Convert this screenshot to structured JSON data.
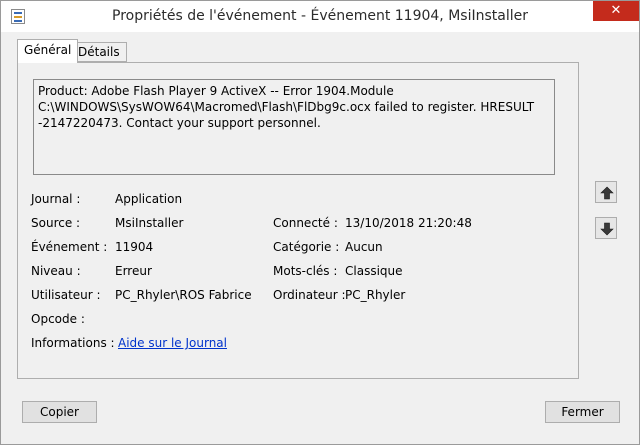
{
  "window": {
    "title": "Propriétés de l'événement - Événement 11904, MsiInstaller",
    "close_glyph": "✕"
  },
  "tabs": [
    {
      "label": "Général",
      "active": true
    },
    {
      "label": "Détails",
      "active": false
    }
  ],
  "description": "Product: Adobe Flash Player 9 ActiveX -- Error 1904.Module C:\\WINDOWS\\SysWOW64\\Macromed\\Flash\\FlDbg9c.ocx failed to register.  HRESULT -2147220473.  Contact your support personnel.",
  "fields": {
    "journal": {
      "label": "Journal :",
      "value": "Application"
    },
    "source": {
      "label": "Source :",
      "value": "MsiInstaller"
    },
    "evenement": {
      "label": "Événement :",
      "value": "11904"
    },
    "niveau": {
      "label": "Niveau :",
      "value": "Erreur"
    },
    "utilisateur": {
      "label": "Utilisateur :",
      "value": "PC_Rhyler\\ROS Fabrice"
    },
    "opcode": {
      "label": "Opcode :",
      "value": ""
    },
    "informations": {
      "label": "Informations :",
      "value": "Aide sur le Journal"
    },
    "connecte": {
      "label": "Connecté :",
      "value": "13/10/2018 21:20:48"
    },
    "categorie": {
      "label": "Catégorie :",
      "value": "Aucun"
    },
    "mots_cles": {
      "label": "Mots-clés :",
      "value": "Classique"
    },
    "ordinateur": {
      "label": "Ordinateur :",
      "value": "PC_Rhyler"
    }
  },
  "buttons": {
    "copy": "Copier",
    "close": "Fermer"
  },
  "icons": {
    "up": "arrow-up-icon",
    "down": "arrow-down-icon"
  }
}
